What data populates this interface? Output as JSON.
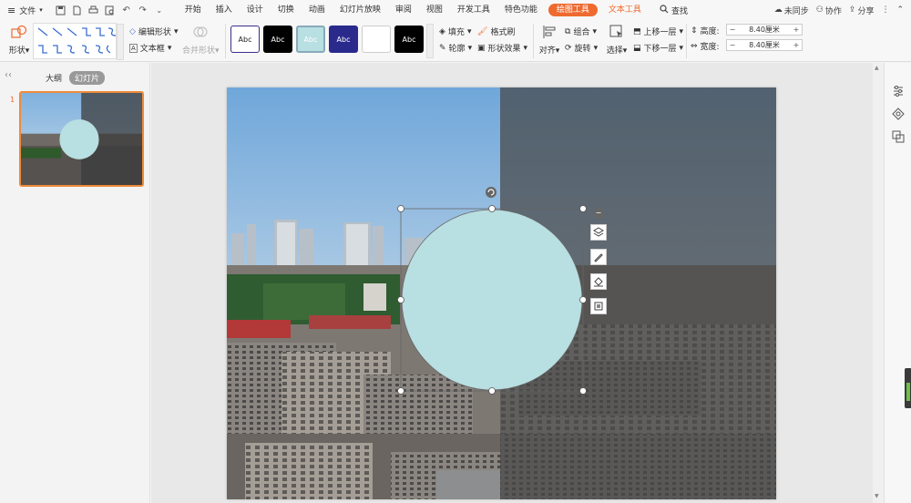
{
  "menubar": {
    "file_label": "文件",
    "tabs": [
      "开始",
      "插入",
      "设计",
      "切换",
      "动画",
      "幻灯片放映",
      "审阅",
      "视图",
      "开发工具",
      "特色功能"
    ],
    "active_tab": "绘图工具",
    "context_tab": "文本工具",
    "search_label": "查找",
    "right": {
      "sync": "未同步",
      "collab": "协作",
      "share": "分享"
    }
  },
  "ribbon": {
    "shape_label": "形状",
    "edit_shape_label": "编辑形状",
    "textbox_label": "文本框",
    "merge_shape_label": "合并形状",
    "style_samples": [
      "Abc",
      "Abc",
      "Abc",
      "Abc",
      "",
      "Abc"
    ],
    "fill_label": "填充",
    "format_painter_label": "格式刷",
    "outline_label": "轮廓",
    "shape_effect_label": "形状效果",
    "align_label": "对齐",
    "group_label": "组合",
    "rotate_label": "旋转",
    "select_label": "选择",
    "bring_forward_label": "上移一层",
    "send_backward_label": "下移一层",
    "height_label": "高度:",
    "height_value": "8.40厘米",
    "width_label": "宽度:",
    "width_value": "8.40厘米"
  },
  "leftpane": {
    "tab_outline": "大纲",
    "tab_slides": "幻灯片",
    "slide_number": "1"
  },
  "colors": {
    "accent": "#ee6a2f",
    "circle_fill": "#b8dfe1",
    "dark_overlay": "rgba(70,70,70,0.72)"
  }
}
